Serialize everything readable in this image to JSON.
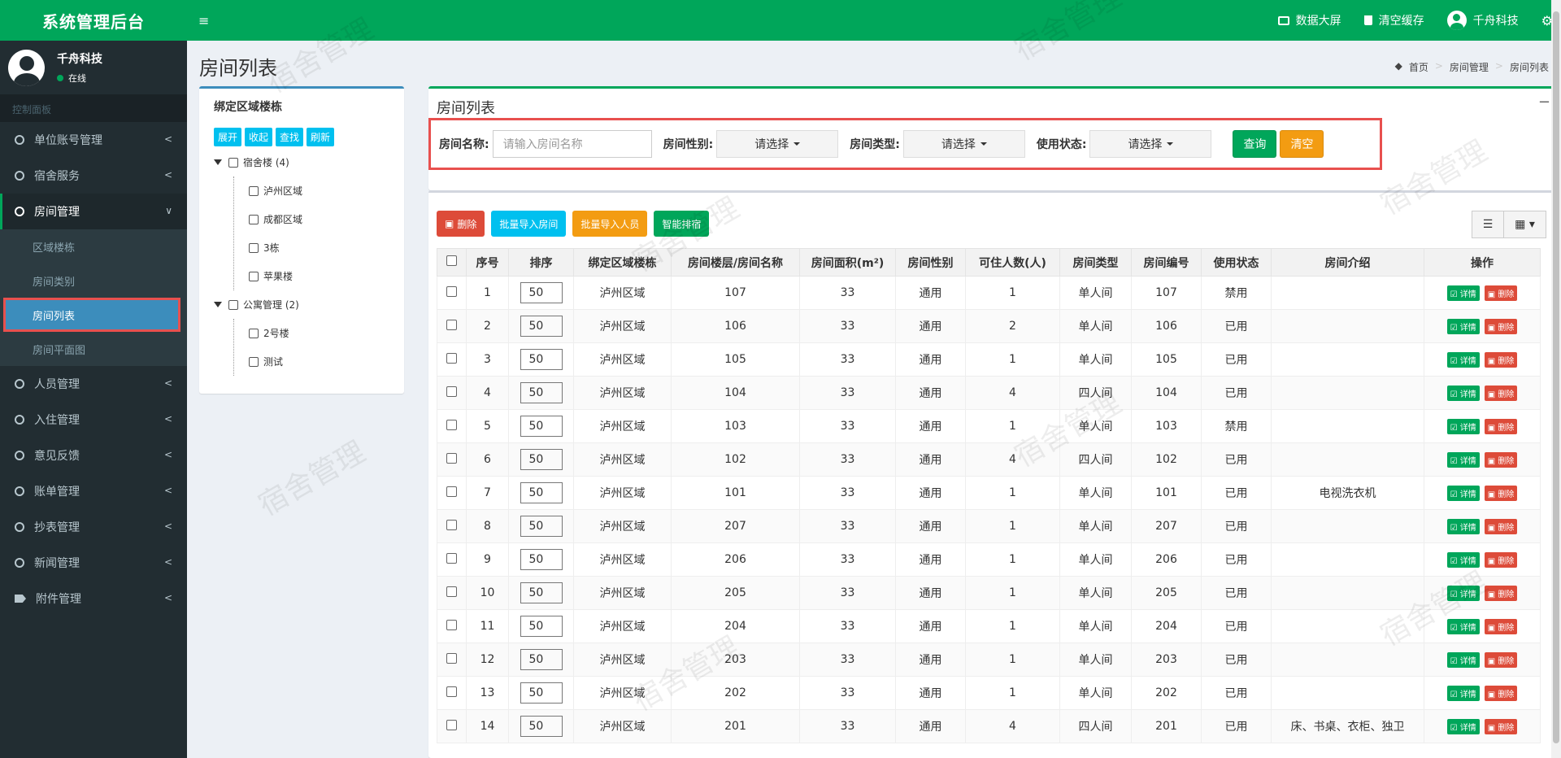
{
  "app": {
    "title": "系统管理后台"
  },
  "user": {
    "name": "千舟科技",
    "status": "在线"
  },
  "sidebar": {
    "header": "控制面板",
    "items": [
      {
        "label": "单位账号管理"
      },
      {
        "label": "宿舍服务"
      },
      {
        "label": "房间管理"
      },
      {
        "label": "人员管理"
      },
      {
        "label": "入住管理"
      },
      {
        "label": "意见反馈"
      },
      {
        "label": "账单管理"
      },
      {
        "label": "抄表管理"
      },
      {
        "label": "新闻管理"
      },
      {
        "label": "附件管理"
      }
    ],
    "sub_items": [
      {
        "label": "区域楼栋"
      },
      {
        "label": "房间类别"
      },
      {
        "label": "房间列表"
      },
      {
        "label": "房间平面图"
      }
    ]
  },
  "topbar": {
    "menu_icon": "≡",
    "big_screen": "数据大屏",
    "clear_cache": "清空缓存",
    "user": "千舟科技",
    "gear_icon": "⚙"
  },
  "page": {
    "title": "房间列表",
    "breadcrumb": [
      "首页",
      "房间管理",
      "房间列表"
    ]
  },
  "tree": {
    "title": "绑定区域楼栋",
    "buttons": [
      "展开",
      "收起",
      "查找",
      "刷新"
    ],
    "groups": [
      {
        "label": "宿舍楼 (4)",
        "children": [
          "泸州区域",
          "成都区域",
          "3栋",
          "苹果楼"
        ]
      },
      {
        "label": "公寓管理 (2)",
        "children": [
          "2号楼",
          "测试"
        ]
      }
    ]
  },
  "search": {
    "box_title": "房间列表",
    "collapse": "−",
    "name_label": "房间名称:",
    "name_placeholder": "请输入房间名称",
    "gender_label": "房间性别:",
    "type_label": "房间类型:",
    "status_label": "使用状态:",
    "select_placeholder": "请选择",
    "query": "查询",
    "clear": "清空"
  },
  "toolbar": {
    "delete": "删除",
    "import_rooms": "批量导入房间",
    "import_people": "批量导入人员",
    "smart_assign": "智能排宿"
  },
  "table": {
    "headers": [
      "序号",
      "排序",
      "绑定区域楼栋",
      "房间楼层/房间名称",
      "房间面积(m²)",
      "房间性别",
      "可住人数(人)",
      "房间类型",
      "房间编号",
      "使用状态",
      "房间介绍",
      "操作"
    ],
    "detail_label": "☑ 详情",
    "delete_label": "删除",
    "rows": [
      [
        "1",
        "50",
        "泸州区域",
        "107",
        "33",
        "通用",
        "1",
        "单人间",
        "107",
        "禁用",
        ""
      ],
      [
        "2",
        "50",
        "泸州区域",
        "106",
        "33",
        "通用",
        "2",
        "单人间",
        "106",
        "已用",
        ""
      ],
      [
        "3",
        "50",
        "泸州区域",
        "105",
        "33",
        "通用",
        "1",
        "单人间",
        "105",
        "已用",
        ""
      ],
      [
        "4",
        "50",
        "泸州区域",
        "104",
        "33",
        "通用",
        "4",
        "四人间",
        "104",
        "已用",
        ""
      ],
      [
        "5",
        "50",
        "泸州区域",
        "103",
        "33",
        "通用",
        "1",
        "单人间",
        "103",
        "禁用",
        ""
      ],
      [
        "6",
        "50",
        "泸州区域",
        "102",
        "33",
        "通用",
        "4",
        "四人间",
        "102",
        "已用",
        ""
      ],
      [
        "7",
        "50",
        "泸州区域",
        "101",
        "33",
        "通用",
        "1",
        "单人间",
        "101",
        "已用",
        "电视洗衣机"
      ],
      [
        "8",
        "50",
        "泸州区域",
        "207",
        "33",
        "通用",
        "1",
        "单人间",
        "207",
        "已用",
        ""
      ],
      [
        "9",
        "50",
        "泸州区域",
        "206",
        "33",
        "通用",
        "1",
        "单人间",
        "206",
        "已用",
        ""
      ],
      [
        "10",
        "50",
        "泸州区域",
        "205",
        "33",
        "通用",
        "1",
        "单人间",
        "205",
        "已用",
        ""
      ],
      [
        "11",
        "50",
        "泸州区域",
        "204",
        "33",
        "通用",
        "1",
        "单人间",
        "204",
        "已用",
        ""
      ],
      [
        "12",
        "50",
        "泸州区域",
        "203",
        "33",
        "通用",
        "1",
        "单人间",
        "203",
        "已用",
        ""
      ],
      [
        "13",
        "50",
        "泸州区域",
        "202",
        "33",
        "通用",
        "1",
        "单人间",
        "202",
        "已用",
        ""
      ],
      [
        "14",
        "50",
        "泸州区域",
        "201",
        "33",
        "通用",
        "4",
        "四人间",
        "201",
        "已用",
        "床、书桌、衣柜、独卫"
      ]
    ]
  },
  "watermark": "宿舍管理",
  "colors": {
    "brand": "#00a65a",
    "sidebar": "#222d32",
    "active_sub": "#3c8dbc",
    "highlight": "#e8504e"
  }
}
